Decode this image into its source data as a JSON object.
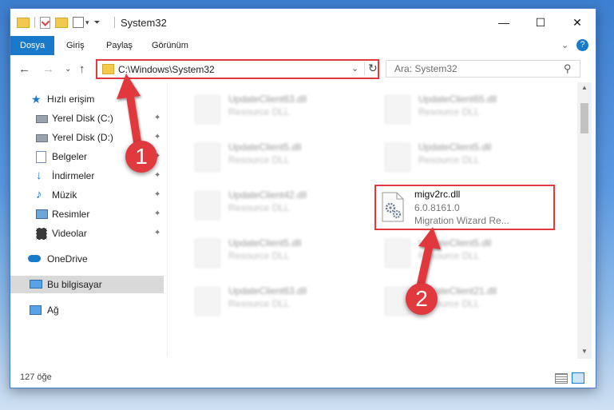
{
  "window": {
    "title": "System32",
    "minimize": "—",
    "maximize": "☐",
    "close": "✕"
  },
  "ribbon": {
    "tabs": [
      "Dosya",
      "Giriş",
      "Paylaş",
      "Görünüm"
    ],
    "expand": "⌄",
    "help": "?"
  },
  "nav": {
    "back": "←",
    "forward": "→",
    "recent": "⌄",
    "up": "↑",
    "address": "C:\\Windows\\System32",
    "address_dropdown": "⌄",
    "refresh": "↻",
    "search_placeholder": "Ara: System32",
    "search_icon": "⚲"
  },
  "sidebar": {
    "items": [
      {
        "label": "Hızlı erişim",
        "icon": "star-icon"
      },
      {
        "label": "Yerel Disk (C:)",
        "icon": "drive-icon"
      },
      {
        "label": "Yerel Disk (D:)",
        "icon": "drive-icon"
      },
      {
        "label": "Belgeler",
        "icon": "documents-icon"
      },
      {
        "label": "İndirmeler",
        "icon": "download-icon"
      },
      {
        "label": "Müzik",
        "icon": "music-icon"
      },
      {
        "label": "Resimler",
        "icon": "pictures-icon"
      },
      {
        "label": "Videolar",
        "icon": "videos-icon"
      },
      {
        "label": "OneDrive",
        "icon": "cloud-icon"
      },
      {
        "label": "Bu bilgisayar",
        "icon": "computer-icon"
      },
      {
        "label": "Ağ",
        "icon": "network-icon"
      }
    ],
    "pin": "📌"
  },
  "files": [
    {
      "name": "UpdateClient63.dll",
      "desc": "Resource DLL"
    },
    {
      "name": "UpdateClient65.dll",
      "desc": "Resource DLL"
    },
    {
      "name": "UpdateClient5.dll",
      "desc": "Resource DLL"
    },
    {
      "name": "UpdateClient5.dll",
      "desc": "Resource DLL"
    },
    {
      "name": "UpdateClient42.dll",
      "desc": "Resource DLL"
    },
    {
      "name": "UpdateClient5.dll",
      "desc": "Resource DLL"
    },
    {
      "name": "UpdateClient5.dll",
      "desc": "Resource DLL"
    },
    {
      "name": "UpdateClient63.dll",
      "desc": "Resource DLL"
    },
    {
      "name": "UpdateClient21.dll",
      "desc": "Resource DLL"
    }
  ],
  "highlighted_file": {
    "name": "migv2rc.dll",
    "version": "6.0.8161.0",
    "description": "Migration Wizard Re..."
  },
  "status": {
    "count": "127 öğe"
  },
  "callouts": [
    "1",
    "2"
  ],
  "colors": {
    "accent": "#1979ca",
    "highlight_red": "#e0393e"
  }
}
